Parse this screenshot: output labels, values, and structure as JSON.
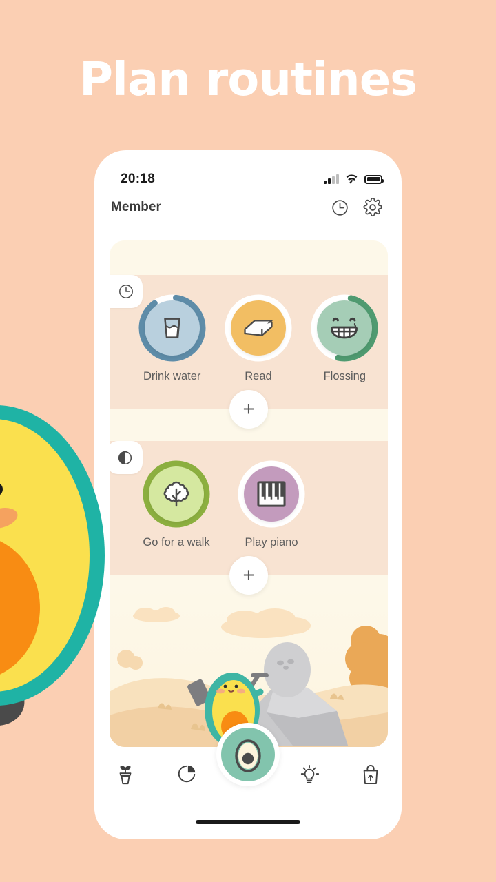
{
  "hero": {
    "title": "Plan routines"
  },
  "theme": {
    "page_bg": "#FBCFB3",
    "card_cream": "#FDF8E9",
    "card_peach": "#F8E3D2",
    "accent_teal": "#82C4AD",
    "text_dark": "#3B3B3B",
    "text_muted": "#5C5C5C"
  },
  "statusbar": {
    "time": "20:18",
    "signal_icon": "signal-bars-icon",
    "wifi_icon": "wifi-icon",
    "battery_icon": "battery-full-icon"
  },
  "header": {
    "title": "Member",
    "clock_icon": "clock-icon",
    "settings_icon": "gear-icon"
  },
  "groups": [
    {
      "badge_icon": "clock-icon",
      "badge_name": "morning-routine-badge",
      "add_label": "+",
      "habits": [
        {
          "label": "Drink water",
          "icon": "water-glass-icon",
          "fill_color": "#B9D0DE",
          "ring_color": "#5E8CA8",
          "progress": 88
        },
        {
          "label": "Read",
          "icon": "book-icon",
          "fill_color": "#F2BE63",
          "ring_color": "#FFFFFF",
          "progress": 0
        },
        {
          "label": "Flossing",
          "icon": "teeth-smile-icon",
          "fill_color": "#A5CDB6",
          "ring_color": "#4F9A70",
          "progress": 50
        }
      ]
    },
    {
      "badge_icon": "contrast-half-moon-icon",
      "badge_name": "evening-routine-badge",
      "add_label": "+",
      "habits": [
        {
          "label": "Go for a walk",
          "icon": "tree-icon",
          "fill_color": "#D5E8A0",
          "ring_color": "#8CAF3F",
          "progress": 100
        },
        {
          "label": "Play piano",
          "icon": "piano-keys-icon",
          "fill_color": "#C39BBD",
          "ring_color": "#FFFFFF",
          "progress": 0
        }
      ]
    }
  ],
  "scene": {
    "description": "avocado character mining a rock with a hammer in a desert landscape",
    "avocado_character": "avocado-miner-character",
    "rock": "gray-boulder",
    "clouds": "cloud-shapes",
    "bushes": "orange-bushes"
  },
  "bottom_nav": {
    "items": [
      {
        "icon": "plant-pot-icon",
        "name": "nav-garden"
      },
      {
        "icon": "pie-chart-icon",
        "name": "nav-stats"
      },
      {
        "icon": "avocado-icon",
        "name": "nav-home",
        "active": true
      },
      {
        "icon": "lightbulb-icon",
        "name": "nav-tips"
      },
      {
        "icon": "shopping-bag-icon",
        "name": "nav-shop"
      }
    ]
  },
  "mascot": {
    "name": "avocado-mascot",
    "skin_color": "#1FB3A5",
    "flesh_color": "#FAE04E",
    "pit_color": "#F88C13"
  }
}
